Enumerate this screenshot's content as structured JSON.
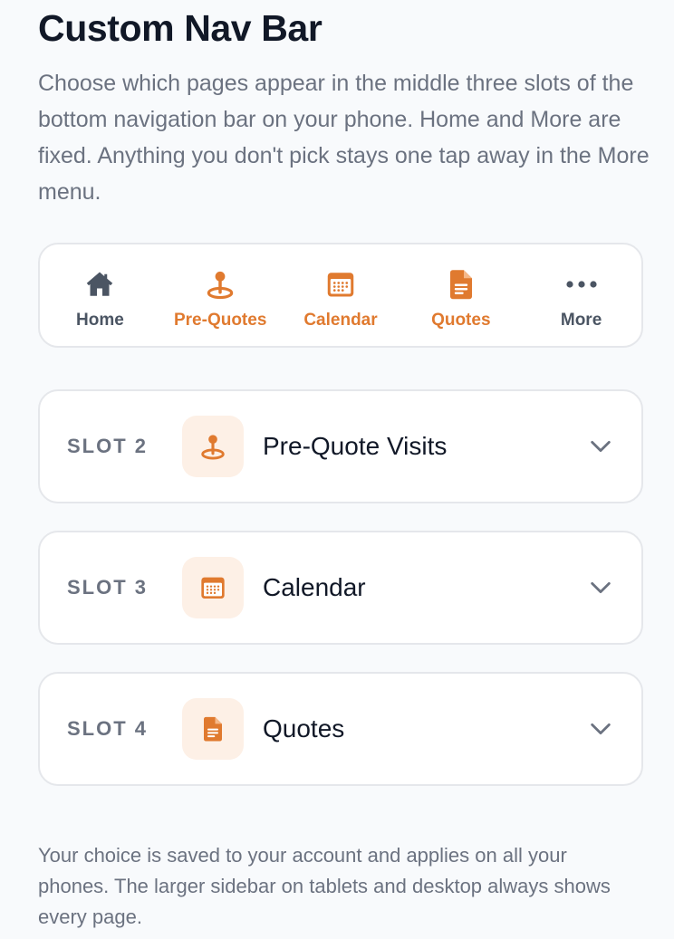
{
  "page": {
    "title": "Custom Nav Bar",
    "intro": "Choose which pages appear in the middle three slots of the bottom navigation bar on your phone. Home and More are fixed. Anything you don't pick stays one tap away in the More menu.",
    "footer": "Your choice is saved to your account and applies on all your phones. The larger sidebar on tablets and desktop always shows every page."
  },
  "navbar": {
    "items": [
      {
        "label": "Home",
        "icon": "house-icon",
        "state": "fixed"
      },
      {
        "label": "Pre-Quotes",
        "icon": "map-pin-icon",
        "state": "selected"
      },
      {
        "label": "Calendar",
        "icon": "calendar-icon",
        "state": "selected"
      },
      {
        "label": "Quotes",
        "icon": "document-icon",
        "state": "selected"
      },
      {
        "label": "More",
        "icon": "ellipsis-icon",
        "state": "fixed"
      }
    ]
  },
  "slots": [
    {
      "label": "SLOT 2",
      "value": "Pre-Quote Visits",
      "icon": "map-pin-icon"
    },
    {
      "label": "SLOT 3",
      "value": "Calendar",
      "icon": "calendar-icon"
    },
    {
      "label": "SLOT 4",
      "value": "Quotes",
      "icon": "document-icon"
    }
  ],
  "colors": {
    "accent": "#e07a2f",
    "accent_soft": "#fdf0e6",
    "muted_text": "#6b7280",
    "border": "#e5e7eb",
    "background": "#f8fafc"
  }
}
